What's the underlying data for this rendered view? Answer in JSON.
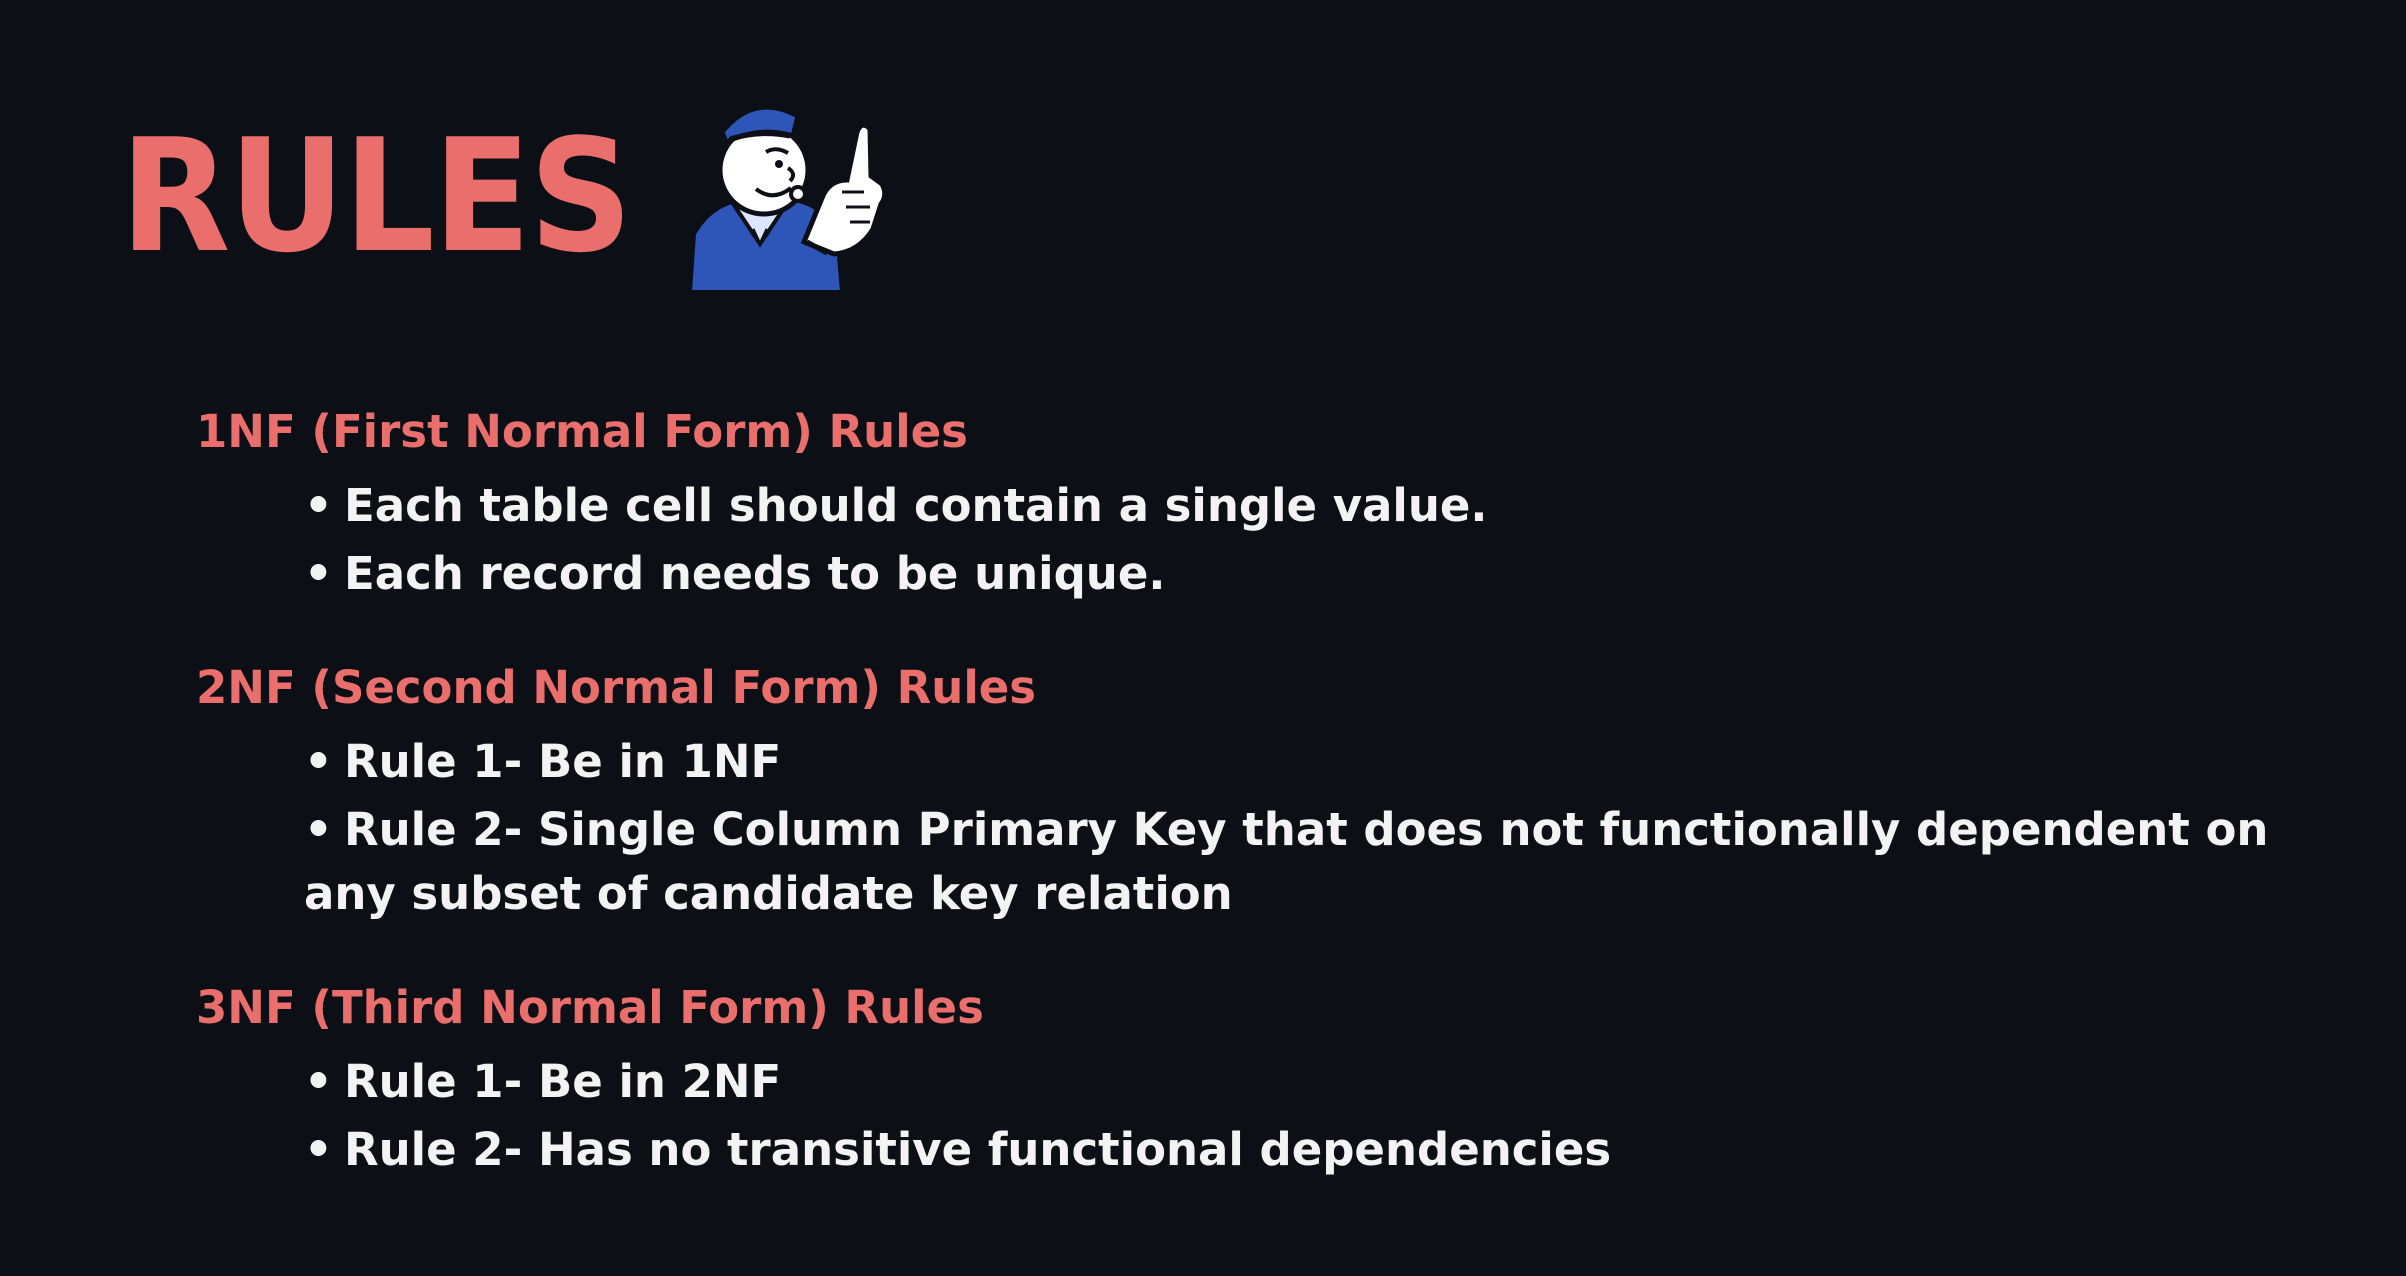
{
  "slide": {
    "title": "RULES",
    "mascot_icon": "monopoly-policeman-pointing",
    "accent_color": "#ea6f6c",
    "background_color": "#0c0f16",
    "text_color": "#f3f3f3"
  },
  "sections": [
    {
      "heading": "1NF (First Normal Form) Rules",
      "rules": [
        "Each table cell should contain a single value.",
        "Each record needs to be unique."
      ]
    },
    {
      "heading": "2NF (Second Normal Form) Rules",
      "rules": [
        "Rule 1- Be in 1NF",
        "Rule 2- Single Column Primary Key that does not functionally dependent on any subset of candidate key relation"
      ]
    },
    {
      "heading": "3NF (Third Normal Form) Rules",
      "rules": [
        "Rule 1- Be in 2NF",
        "Rule 2- Has no transitive functional dependencies"
      ]
    }
  ]
}
